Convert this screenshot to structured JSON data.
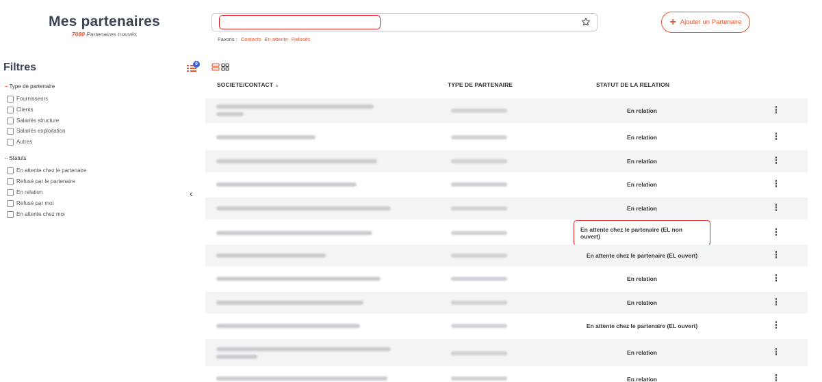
{
  "header": {
    "title": "Mes partenaires",
    "count": "7080",
    "count_suffix": "Partenaires trouvés"
  },
  "search": {
    "value": "",
    "placeholder": ""
  },
  "favoris": {
    "label": "Favoris :",
    "links": [
      "Contacts",
      "En attente",
      "Refusés"
    ]
  },
  "add_button": {
    "label": "Ajouter un Partenaire"
  },
  "sidebar": {
    "title": "Filtres",
    "badge": "0",
    "groups": [
      {
        "title": "Type de partenaire",
        "items": [
          "Fournisseurs",
          "Clients",
          "Salariés structure",
          "Salariés exploitation",
          "Autres"
        ]
      },
      {
        "title": "Statuts",
        "items": [
          "En attente chez le partenaire",
          "Refusé par le partenaire",
          "En relation",
          "Refusé par moi",
          "En attente chez moi"
        ]
      }
    ]
  },
  "table": {
    "columns": [
      "SOCIETE/CONTACT",
      "TYPE DE PARTENAIRE",
      "STATUT DE LA RELATION"
    ],
    "rows": [
      {
        "status": "En relation",
        "highlight": false
      },
      {
        "status": "En relation",
        "highlight": false
      },
      {
        "status": "En relation",
        "highlight": false
      },
      {
        "status": "En relation",
        "highlight": false
      },
      {
        "status": "En relation",
        "highlight": false
      },
      {
        "status": "En attente chez le partenaire (EL non ouvert)",
        "highlight": true
      },
      {
        "status": "En attente chez le partenaire (EL ouvert)",
        "highlight": false
      },
      {
        "status": "En relation",
        "highlight": false
      },
      {
        "status": "En relation",
        "highlight": false
      },
      {
        "status": "En attente chez le partenaire (EL ouvert)",
        "highlight": false
      },
      {
        "status": "En relation",
        "highlight": false
      },
      {
        "status": "En relation",
        "highlight": false
      }
    ]
  },
  "colors": {
    "accent": "#e8542f",
    "highlight": "#e02020",
    "badge": "#3a5fd8"
  }
}
